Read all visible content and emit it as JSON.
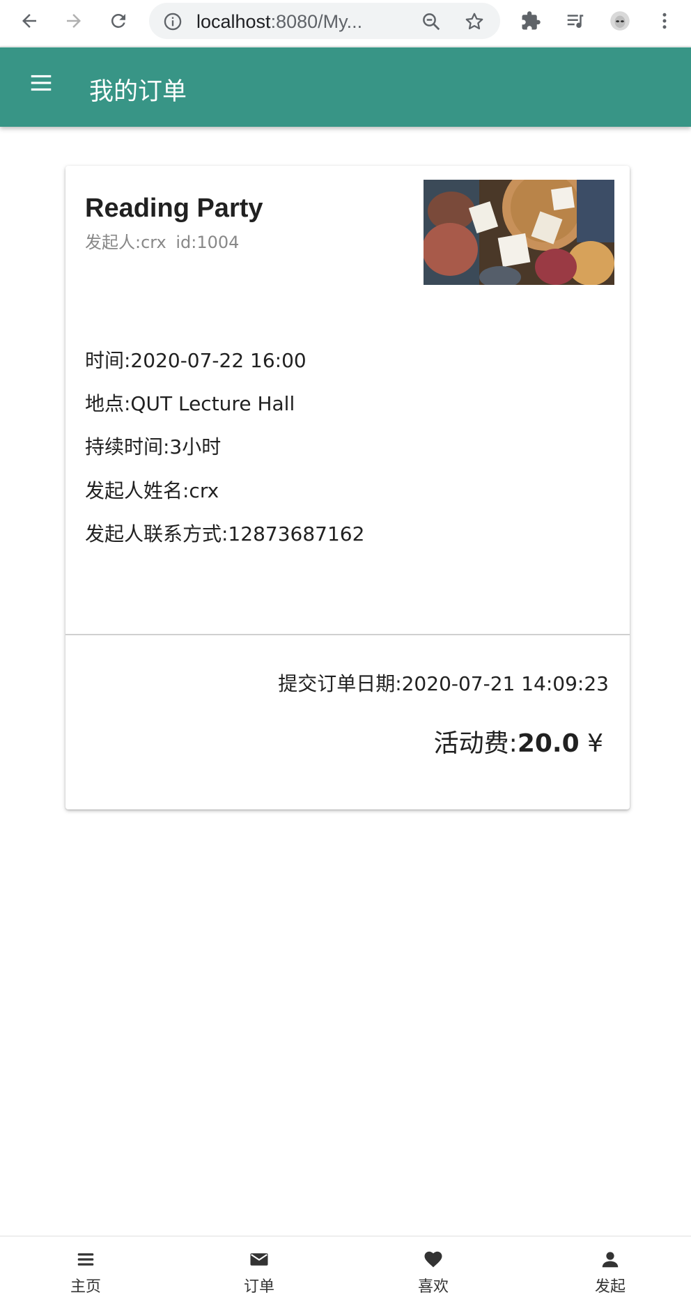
{
  "browser": {
    "url_host": "localhost",
    "url_rest": ":8080/My..."
  },
  "app_bar": {
    "title": "我的订单"
  },
  "order": {
    "title": "Reading Party",
    "subtitle": "发起人:crx  id:1004",
    "time": "时间:2020-07-22 16:00",
    "location": "地点:QUT Lecture Hall",
    "duration": "持续时间:3小时",
    "organizer_name": "发起人姓名:crx",
    "organizer_contact": "发起人联系方式:12873687162",
    "submit_date": "提交订单日期:2020-07-21 14:09:23",
    "fee_label": "活动费:",
    "fee_amount": "20.0",
    "fee_currency": "¥"
  },
  "bottom_nav": {
    "items": [
      {
        "label": "主页",
        "icon": "menu-icon"
      },
      {
        "label": "订单",
        "icon": "mail-icon"
      },
      {
        "label": "喜欢",
        "icon": "heart-icon"
      },
      {
        "label": "发起",
        "icon": "person-icon"
      }
    ]
  },
  "colors": {
    "app_bar": "#389586",
    "text": "#212121",
    "subtitle": "#888888"
  }
}
